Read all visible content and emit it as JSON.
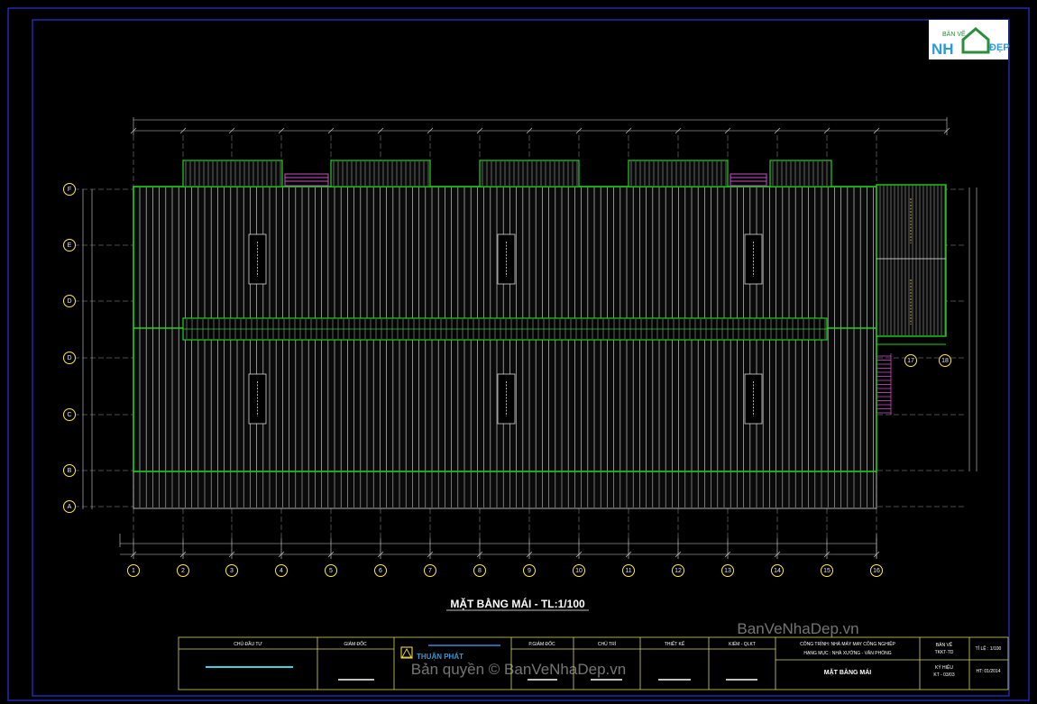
{
  "logo": {
    "top_text": "BẢN VẼ",
    "left_text": "NH",
    "right_text": "ĐẸP"
  },
  "plan": {
    "title": "MẶT BẰNG MÁI - TL:1/100",
    "axis_numbers": [
      "1",
      "2",
      "3",
      "4",
      "5",
      "6",
      "7",
      "8",
      "9",
      "10",
      "11",
      "12",
      "13",
      "14",
      "15",
      "16"
    ],
    "axis_numbers_side": [
      "17",
      "18"
    ],
    "axis_letters": [
      "F",
      "E",
      "D",
      "D",
      "C",
      "B",
      "A"
    ]
  },
  "title_block": {
    "investor_label": "CHỦ ĐẦU TƯ",
    "director_label": "GIÁM ĐỐC",
    "company_name": "THUẬN PHÁT",
    "deputy_director_label": "P.GIÁM ĐỐC",
    "lead_label": "CHỦ TRÌ",
    "designer_label": "THIẾT KẾ",
    "checker_label": "KIỂM - QLKT",
    "project_line1": "CÔNG TRÌNH: NHÀ MÁY MAY CÔNG NGHIỆP",
    "project_line2": "HẠNG MỤC : NHÀ XƯỞNG - VĂN PHÒNG",
    "sheet_title": "MẶT BẰNG MÁI",
    "drawing_label": "BẢN VẼ",
    "drawing_value": "TKKT-TD",
    "scale_label": "TỈ LỆ : 1/100",
    "code_label": "KÝ HIỆU",
    "code_value": "KT - 03/03",
    "date_label": "HT: 01/2014"
  },
  "watermark": {
    "top": "BanVeNhaDep.vn",
    "bottom": "Bản quyền © BanVeNhaDep.vn"
  },
  "colors": {
    "roof_outline": "#1fd11f",
    "frame_blue": "#2a32d8",
    "magenta": "#d04cd0",
    "yellow": "#ffe94a",
    "grid": "#9a9a9a"
  }
}
